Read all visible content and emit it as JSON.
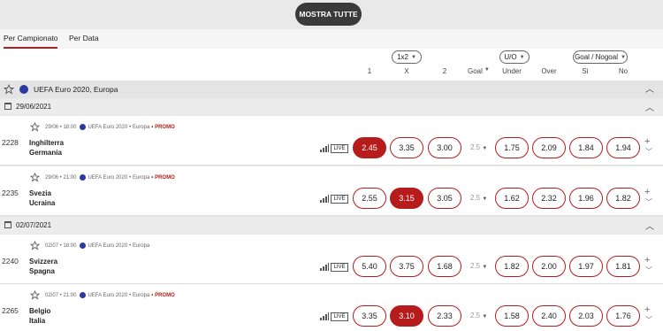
{
  "top": {
    "show_all": "MOSTRA TUTTE"
  },
  "tabs": [
    "Per Campionato",
    "Per Data"
  ],
  "market_selectors": [
    {
      "label": "1x2"
    },
    {
      "label": "Goal"
    },
    {
      "label": "U/O"
    },
    {
      "label": "Goal / Nogoal"
    }
  ],
  "columns": [
    "1",
    "X",
    "2",
    "Under",
    "Over",
    "Sì",
    "No"
  ],
  "competition": {
    "title": "UEFA Euro 2020, Europa"
  },
  "dates": [
    "29/06/2021",
    "02/07/2021"
  ],
  "events": [
    {
      "code": "2228",
      "datetime": "29/06 • 18:00",
      "league": "UEFA Euro 2020",
      "region": "• Europa",
      "promo": "• PROMO",
      "home": "Inghilterra",
      "away": "Germania",
      "live": "LIVE",
      "odds": [
        "2.45",
        "3.35",
        "3.00"
      ],
      "goal_line": "2.5",
      "uo": [
        "1.75",
        "2.09"
      ],
      "gng": [
        "1.84",
        "1.94"
      ],
      "highlight": 0
    },
    {
      "code": "2235",
      "datetime": "29/06 • 21:00",
      "league": "UEFA Euro 2020",
      "region": "• Europa",
      "promo": "• PROMO",
      "home": "Svezia",
      "away": "Ucraina",
      "live": "LIVE",
      "odds": [
        "2.55",
        "3.15",
        "3.05"
      ],
      "goal_line": "2.5",
      "uo": [
        "1.62",
        "2.32"
      ],
      "gng": [
        "1.96",
        "1.82"
      ],
      "highlight": 1
    },
    {
      "code": "2240",
      "datetime": "02/07 • 18:00",
      "league": "UEFA Euro 2020",
      "region": "• Europa",
      "promo": "",
      "home": "Svizzera",
      "away": "Spagna",
      "live": "LIVE",
      "odds": [
        "5.40",
        "3.75",
        "1.68"
      ],
      "goal_line": "2.5",
      "uo": [
        "1.82",
        "2.00"
      ],
      "gng": [
        "1.97",
        "1.81"
      ],
      "highlight": -1
    },
    {
      "code": "2265",
      "datetime": "02/07 • 21:00",
      "league": "UEFA Euro 2020",
      "region": "• Europa",
      "promo": "• PROMO",
      "home": "Belgio",
      "away": "Italia",
      "live": "LIVE",
      "odds": [
        "3.35",
        "3.10",
        "2.33"
      ],
      "goal_line": "2.5",
      "uo": [
        "1.58",
        "2.40"
      ],
      "gng": [
        "2.03",
        "1.76"
      ],
      "highlight": 1
    }
  ],
  "colors": {
    "accent": "#b71c1c",
    "competition_flag": "#2b3a9c"
  }
}
